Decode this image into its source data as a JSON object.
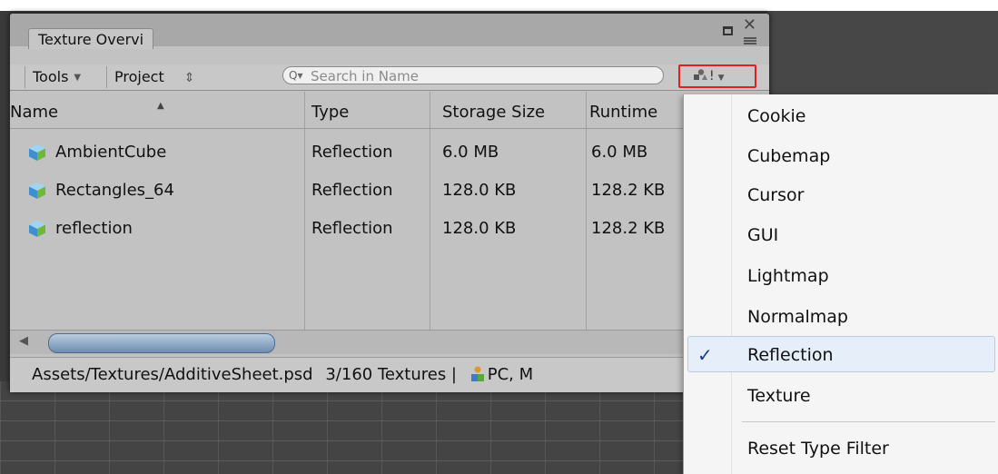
{
  "window": {
    "tab_title": "Texture Overvi"
  },
  "toolbar": {
    "tools_label": "Tools",
    "project_label": "Project",
    "project_arrows": "⇕",
    "search_placeholder": "Search in Name",
    "filter_glyph": "!"
  },
  "table": {
    "columns": [
      "Name",
      "Type",
      "Storage Size",
      "Runtime"
    ],
    "rows": [
      {
        "name": "AmbientCube",
        "type": "Reflection",
        "storage": "6.0 MB",
        "runtime": "6.0 MB"
      },
      {
        "name": "Rectangles_64",
        "type": "Reflection",
        "storage": "128.0 KB",
        "runtime": "128.2 KB"
      },
      {
        "name": "reflection",
        "type": "Reflection",
        "storage": "128.0 KB",
        "runtime": "128.2 KB"
      }
    ]
  },
  "status": {
    "path": "Assets/Textures/AdditiveSheet.psd",
    "count": "3/160 Textures |",
    "platform": "PC, M"
  },
  "menu": {
    "items": [
      "Cookie",
      "Cubemap",
      "Cursor",
      "GUI",
      "Lightmap",
      "Normalmap",
      "Reflection",
      "Texture"
    ],
    "selected": "Reflection",
    "reset": "Reset Type Filter"
  },
  "colors": {
    "highlight_border": "#e02020",
    "selected_bg": "#e6eef9",
    "scroll_thumb": "#6e8cb0"
  }
}
